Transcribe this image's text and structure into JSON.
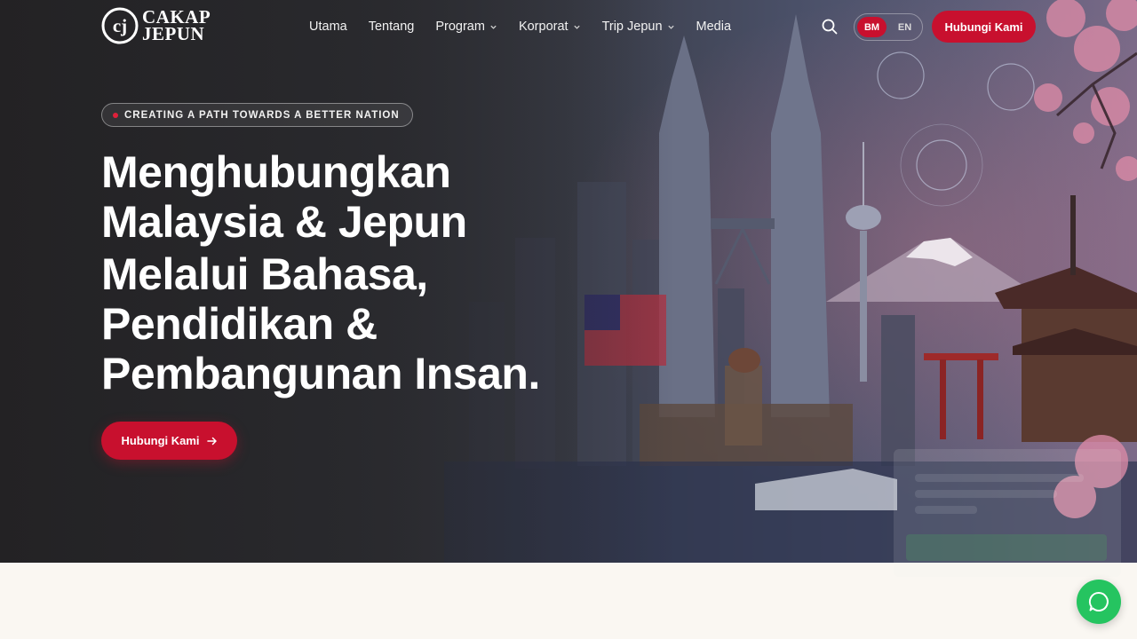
{
  "brand": {
    "line1": "CAKAP",
    "line2": "JEPUN",
    "mark": "cj"
  },
  "nav": {
    "items": [
      {
        "label": "Utama",
        "dropdown": false
      },
      {
        "label": "Tentang",
        "dropdown": false
      },
      {
        "label": "Program",
        "dropdown": true
      },
      {
        "label": "Korporat",
        "dropdown": true
      },
      {
        "label": "Trip Jepun",
        "dropdown": true
      },
      {
        "label": "Media",
        "dropdown": false
      }
    ],
    "search_icon": "search-icon",
    "lang": {
      "bm": "BM",
      "en": "EN",
      "active": "BM"
    },
    "cta": "Hubungi Kami"
  },
  "hero": {
    "tagline": "CREATING A PATH TOWARDS A BETTER NATION",
    "title_lines": [
      "Menghubungkan",
      "Malaysia & Jepun",
      "Melalui Bahasa,",
      "Pendidikan &",
      "Pembangunan Insan."
    ],
    "cta": "Hubungi Kami"
  },
  "colors": {
    "accent": "#c8102e",
    "whatsapp": "#25c460",
    "section_bg": "#faf7f2"
  },
  "whatsapp": {
    "icon": "whatsapp-icon"
  }
}
